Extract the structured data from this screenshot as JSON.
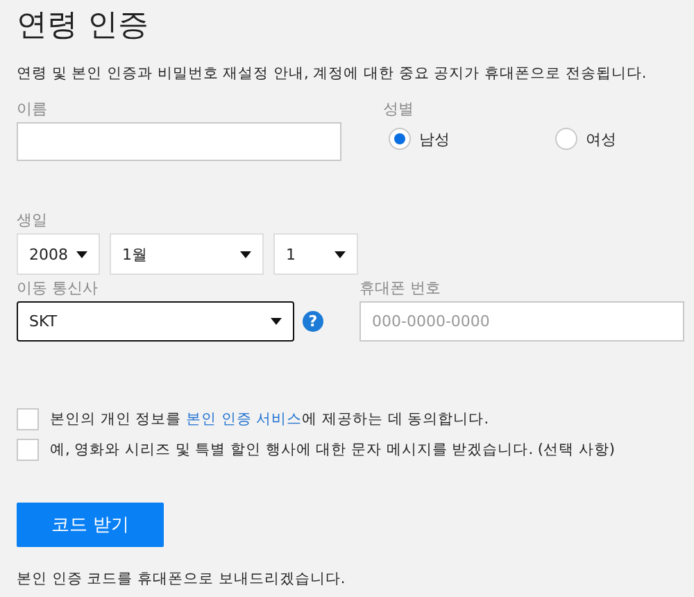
{
  "title": "연령 인증",
  "description": "연령 및 본인 인증과 비밀번호 재설정 안내, 계정에 대한 중요 공지가 휴대폰으로 전송됩니다.",
  "name_field": {
    "label": "이름"
  },
  "gender": {
    "label": "성별",
    "options": [
      {
        "label": "남성",
        "selected": true
      },
      {
        "label": "여성",
        "selected": false
      }
    ]
  },
  "birthday": {
    "label": "생일",
    "selects": [
      {
        "value": "2008",
        "kind": "year"
      },
      {
        "value": "1월",
        "kind": "month"
      },
      {
        "value": "1",
        "kind": "day"
      }
    ]
  },
  "carrier": {
    "label": "이동 통신사",
    "value": "SKT",
    "help": "?"
  },
  "phone": {
    "label": "휴대폰 번호",
    "placeholder": "000-0000-0000"
  },
  "agreements": [
    {
      "text_before": "본인의 개인 정보를 ",
      "link": "본인 인증 서비스",
      "text_after": "에 제공하는 데 동의합니다.",
      "checked": false
    },
    {
      "text_before": "예, 영화와 시리즈 및 특별 할인 행사에 대한 문자 메시지를 받겠습니다. (선택 사항)",
      "checked": false
    }
  ],
  "submit_button": "코드 받기",
  "footer": "본인 인증 코드를 휴대폰으로 보내드리겠습니다."
}
